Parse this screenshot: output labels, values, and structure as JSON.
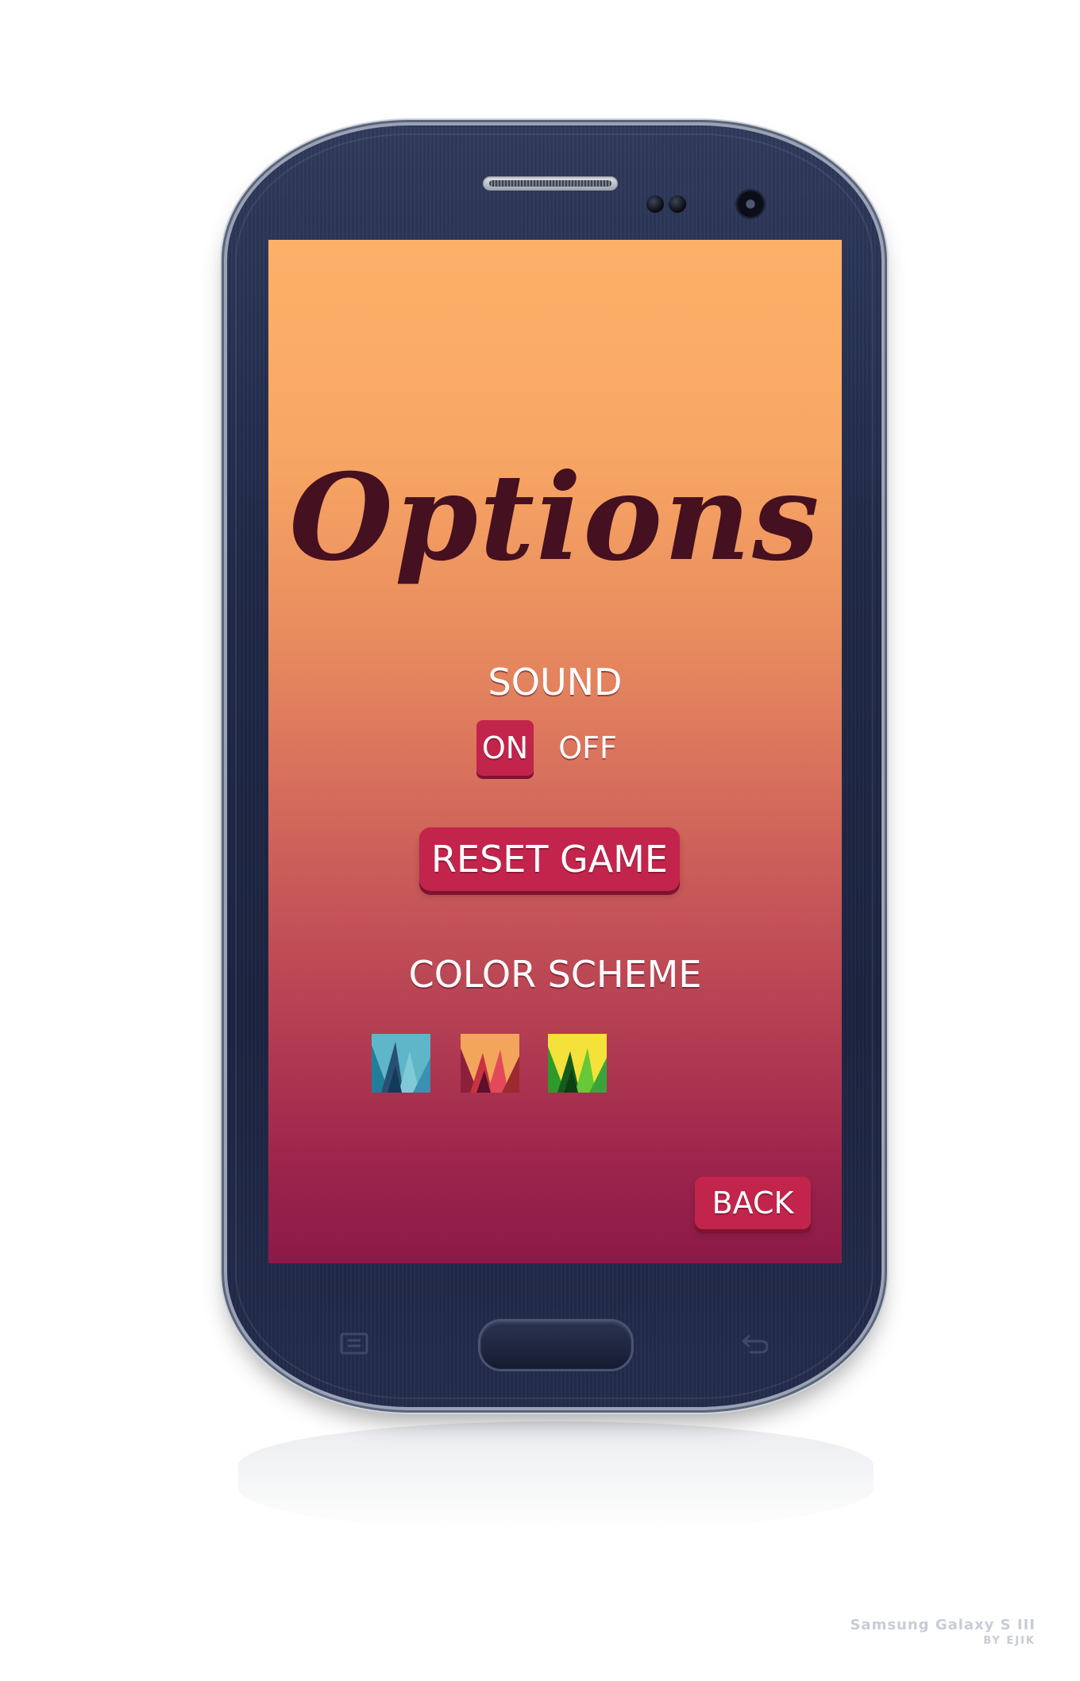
{
  "screen": {
    "title": "Options",
    "sound": {
      "label": "SOUND",
      "on_label": "ON",
      "off_label": "OFF",
      "selected": "ON"
    },
    "reset_label": "RESET GAME",
    "color_scheme": {
      "label": "COLOR SCHEME",
      "options": [
        "blue",
        "red",
        "green"
      ]
    },
    "back_label": "BACK"
  },
  "colors": {
    "gradient_top": "#fdb068",
    "gradient_bottom": "#8c1948",
    "title_color": "#45101f",
    "button_color": "#c2244b"
  },
  "device": {
    "credit_line1": "Samsung Galaxy S III",
    "credit_line2": "BY EJIK"
  }
}
